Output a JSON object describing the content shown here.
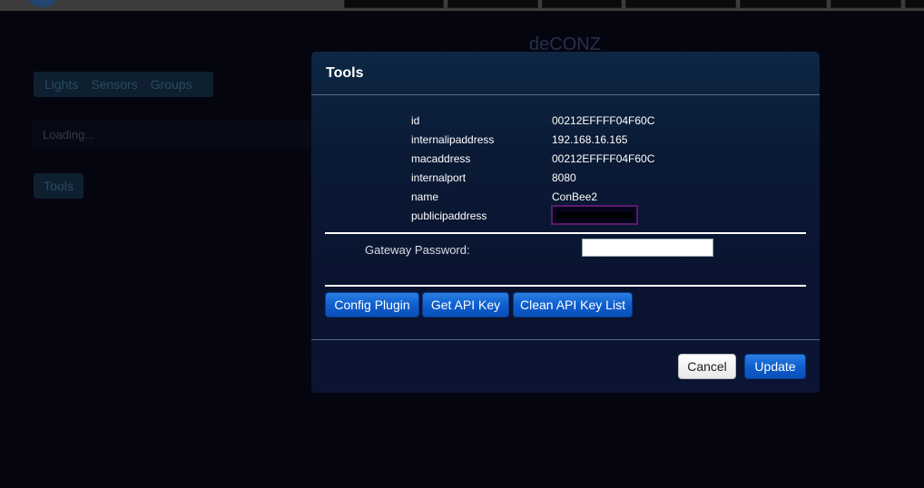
{
  "app": {
    "title": "deCONZ",
    "nav_items": [
      {
        "label": "Lights"
      },
      {
        "label": "Sensors"
      },
      {
        "label": "Groups"
      }
    ],
    "loading_text": "Loading...",
    "tools_button": "Tools"
  },
  "dialog": {
    "title": "Tools",
    "info": [
      {
        "key": "id",
        "value": "00212EFFFF04F60C"
      },
      {
        "key": "internalipaddress",
        "value": "192.168.16.165"
      },
      {
        "key": "macaddress",
        "value": "00212EFFFF04F60C"
      },
      {
        "key": "internalport",
        "value": "8080"
      },
      {
        "key": "name",
        "value": "ConBee2"
      },
      {
        "key": "publicipaddress",
        "value": ""
      }
    ],
    "password_label": "Gateway Password:",
    "password_value": "",
    "buttons": {
      "config_plugin": "Config Plugin",
      "get_api_key": "Get API Key",
      "clean_api_key_list": "Clean API Key List",
      "cancel": "Cancel",
      "update": "Update"
    }
  },
  "colors": {
    "accent_blue": "#0f5fcf",
    "dialog_bg": "#0a1a35",
    "page_bg": "#050510"
  }
}
